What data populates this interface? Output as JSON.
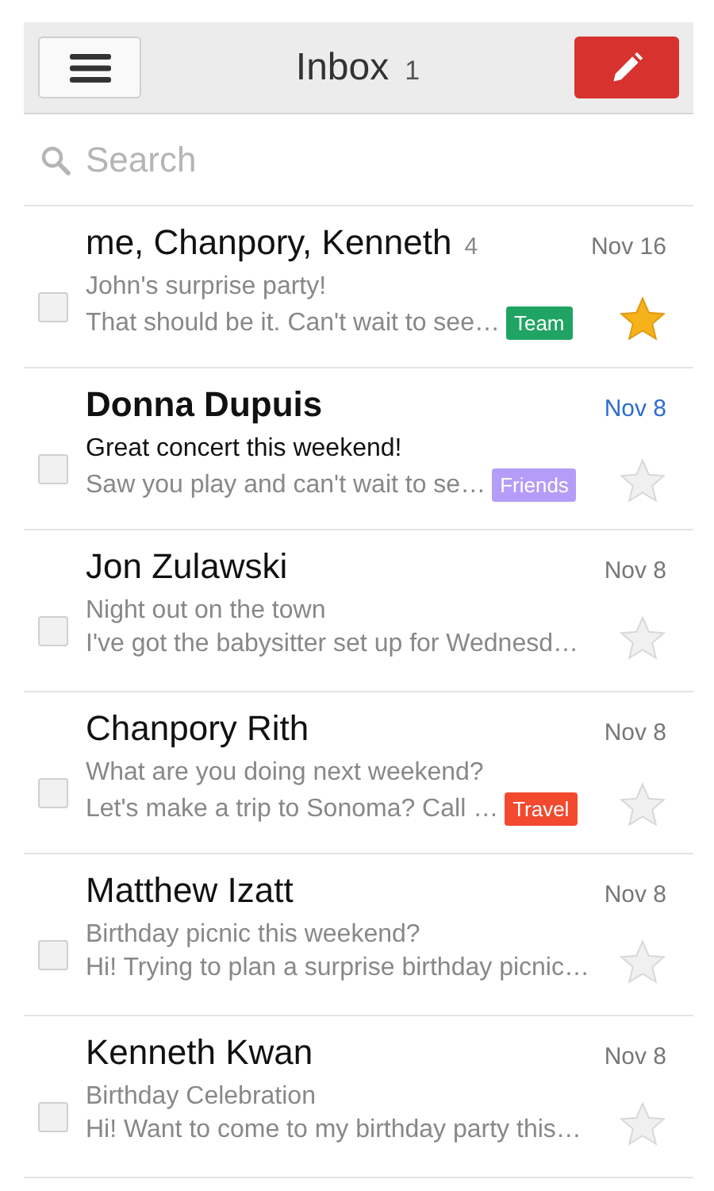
{
  "header": {
    "title": "Inbox",
    "count": "1"
  },
  "search": {
    "placeholder": "Search"
  },
  "messages": [
    {
      "sender": "me, Chanpory, Kenneth",
      "thread_count": "4",
      "date": "Nov 16",
      "subject": "John's surprise party!",
      "snippet": "That should be it. Can't wait to see…",
      "label": {
        "text": "Team",
        "color": "#1fa463"
      },
      "unread": false,
      "starred": true,
      "checked": false
    },
    {
      "sender": "Donna Dupuis",
      "date": "Nov 8",
      "subject": "Great concert this weekend!",
      "snippet": "Saw you play and can't wait to se…",
      "label": {
        "text": "Friends",
        "color": "#b49cf8"
      },
      "unread": true,
      "starred": false,
      "checked": false
    },
    {
      "sender": "Jon Zulawski",
      "date": "Nov 8",
      "subject": "Night out on the town",
      "snippet": "I've got the babysitter set up for Wednesd…",
      "unread": false,
      "starred": false,
      "checked": false
    },
    {
      "sender": "Chanpory Rith",
      "date": "Nov 8",
      "subject": "What are you doing next weekend?",
      "snippet": "Let's make a trip to Sonoma? Call …",
      "label": {
        "text": "Travel",
        "color": "#f2492f"
      },
      "unread": false,
      "starred": false,
      "checked": false
    },
    {
      "sender": "Matthew Izatt",
      "date": "Nov 8",
      "subject": "Birthday picnic this weekend?",
      "snippet": "Hi! Trying to plan a surprise birthday picnic…",
      "unread": false,
      "starred": false,
      "checked": false
    },
    {
      "sender": "Kenneth Kwan",
      "date": "Nov 8",
      "subject": "Birthday Celebration",
      "snippet": "Hi! Want to come to my birthday party this…",
      "unread": false,
      "starred": false,
      "checked": false
    }
  ]
}
